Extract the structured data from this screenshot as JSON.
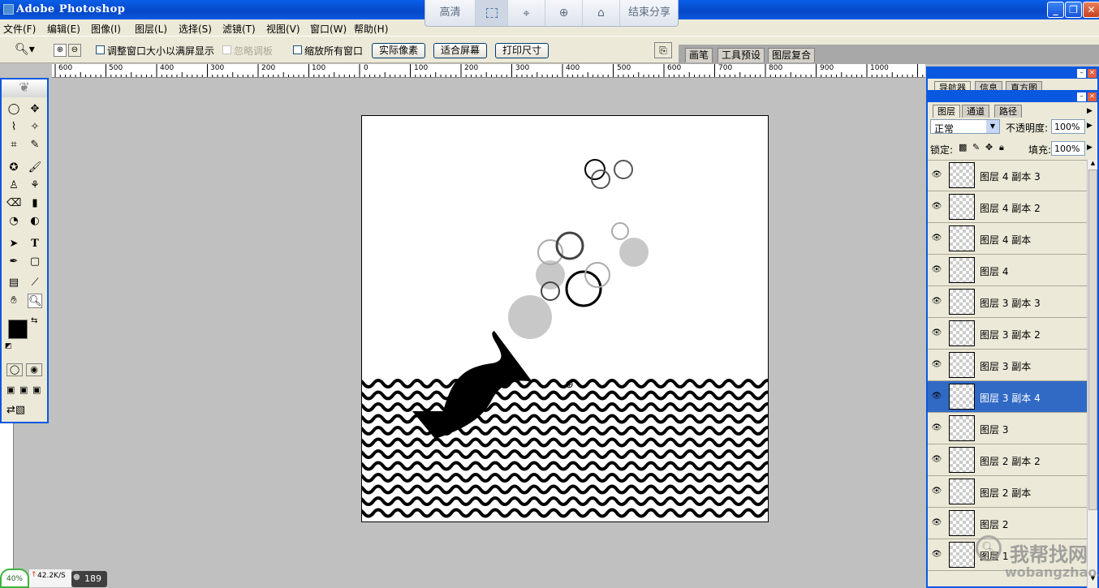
{
  "window": {
    "title": "Adobe Photoshop"
  },
  "share_toolbar": {
    "hd_label": "高清",
    "end_share_label": "结束分享"
  },
  "menu": [
    "文件(F)",
    "编辑(E)",
    "图像(I)",
    "图层(L)",
    "选择(S)",
    "滤镜(T)",
    "视图(V)",
    "窗口(W)",
    "帮助(H)"
  ],
  "options": {
    "resize_window_label": "调整窗口大小以满屏显示",
    "ignore_palettes_label": "忽略调板",
    "zoom_all_label": "缩放所有窗口",
    "actual_pixels_btn": "实际像素",
    "fit_screen_btn": "适合屏幕",
    "print_size_btn": "打印尺寸",
    "palette_tabs": [
      "画笔",
      "工具预设",
      "图层复合"
    ]
  },
  "ruler": {
    "h_labels": [
      "600",
      "500",
      "400",
      "300",
      "200",
      "100",
      "0",
      "100",
      "200",
      "300",
      "400",
      "500",
      "600",
      "700",
      "800",
      "900",
      "1000"
    ]
  },
  "navigator_panel": {
    "tabs": [
      "导航器",
      "信息",
      "直方图"
    ]
  },
  "layers_panel": {
    "tabs": [
      "图层",
      "通道",
      "路径"
    ],
    "blend_mode": "正常",
    "opacity_label": "不透明度:",
    "opacity_value": "100%",
    "lock_label": "锁定:",
    "fill_label": "填充:",
    "fill_value": "100%",
    "layers": [
      {
        "name": "图层 4 副本 3",
        "selected": false
      },
      {
        "name": "图层 4 副本 2",
        "selected": false
      },
      {
        "name": "图层 4 副本",
        "selected": false
      },
      {
        "name": "图层 4",
        "selected": false
      },
      {
        "name": "图层 3 副本 3",
        "selected": false
      },
      {
        "name": "图层 3 副本 2",
        "selected": false
      },
      {
        "name": "图层 3 副本",
        "selected": false
      },
      {
        "name": "图层 3 副本 4",
        "selected": true
      },
      {
        "name": "图层 3",
        "selected": false
      },
      {
        "name": "图层 2 副本 2",
        "selected": false
      },
      {
        "name": "图层 2 副本",
        "selected": false
      },
      {
        "name": "图层 2",
        "selected": false
      },
      {
        "name": "图层 1",
        "selected": false
      }
    ]
  },
  "status": {
    "percent": "40%",
    "speed": "42.2K/S",
    "count": "189"
  },
  "watermark": {
    "cn": "我帮找网",
    "en": "wobangzhao.com"
  },
  "colors": {
    "title_blue": "#0548c8",
    "selected_layer": "#316ac5",
    "chrome": "#ece9d8",
    "workspace": "#c0c0c0"
  }
}
